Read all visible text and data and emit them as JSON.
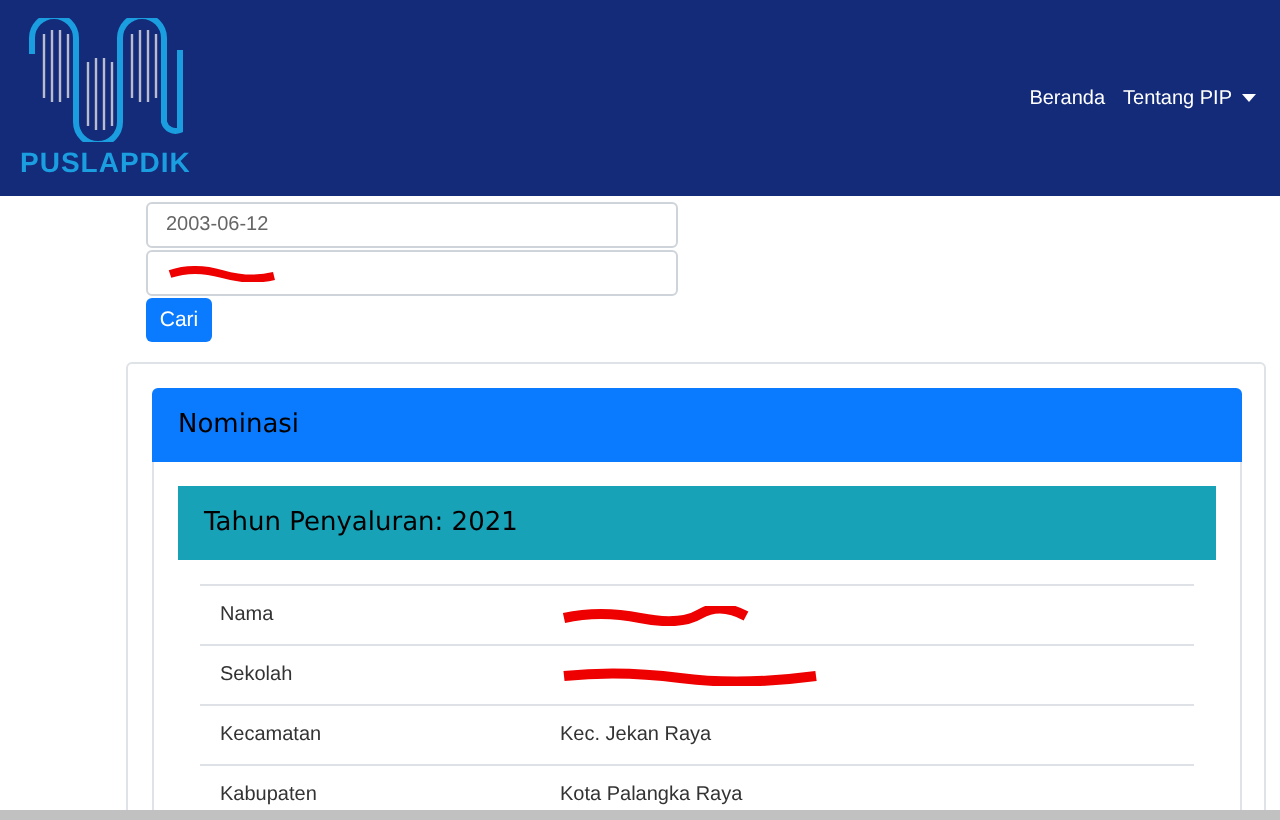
{
  "navbar": {
    "brand": "PUSLAPDIK",
    "links": [
      {
        "label": "Beranda",
        "dropdown": false
      },
      {
        "label": "Tentang PIP",
        "dropdown": true
      }
    ]
  },
  "search": {
    "fields": [
      {
        "value": "2003-06-12",
        "redacted": false
      },
      {
        "redacted": true
      }
    ],
    "button": "Cari"
  },
  "card": {
    "title": "Nominasi",
    "section_title": "Tahun Penyaluran: 2021",
    "rows": [
      {
        "label": "Nama",
        "redacted": true
      },
      {
        "label": "Sekolah",
        "redacted": true
      },
      {
        "label": "Kecamatan",
        "value": "Kec. Jekan Raya",
        "redacted": false
      },
      {
        "label": "Kabupaten",
        "value": "Kota Palangka Raya",
        "redacted": false
      }
    ]
  }
}
